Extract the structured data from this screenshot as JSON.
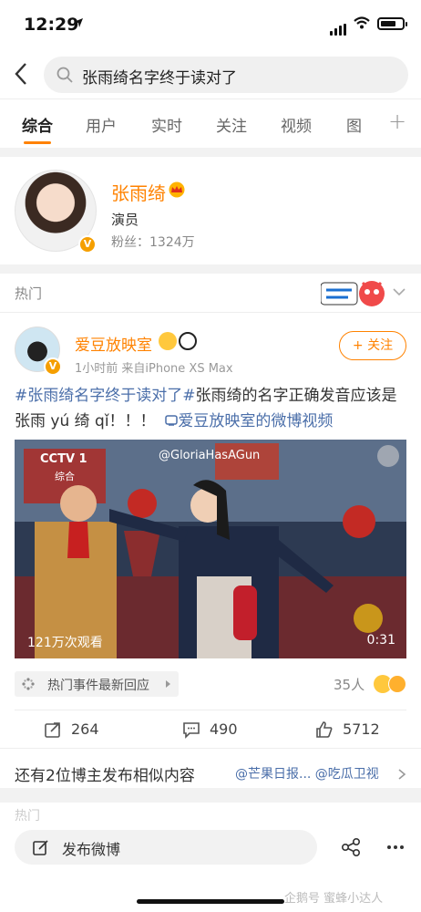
{
  "status": {
    "time": "12:29"
  },
  "search": {
    "query": "张雨绮名字终于读对了"
  },
  "tabs": [
    {
      "label": "综合"
    },
    {
      "label": "用户"
    },
    {
      "label": "实时"
    },
    {
      "label": "关注"
    },
    {
      "label": "视频"
    },
    {
      "label": "图"
    }
  ],
  "user_card": {
    "name": "张雨绮",
    "title": "演员",
    "fans": "粉丝：1324万"
  },
  "post": {
    "section_label": "热门",
    "author": "爱豆放映室",
    "meta": "1小时前  来自iPhone XS Max",
    "follow_label": "+ 关注",
    "hashtag": "#张雨绮名字终于读对了#",
    "body": "张雨绮的名字正确发音应该是张雨 yú 绮 qǐ！！！",
    "video_link": "爱豆放映室的微博视频",
    "video": {
      "watermark": "@GloriaHasAGun",
      "channel": "CCTV 1",
      "channel_sub": "综合",
      "views": "121万次观看",
      "duration": "0:31"
    },
    "event_tag": "热门事件最新回应",
    "reactors": "35人",
    "shares": "264",
    "comments": "490",
    "likes": "5712"
  },
  "similar": {
    "text": "还有2位博主发布相似内容",
    "links": "@芒果日报... @吃瓜卫视"
  },
  "peek_label": "热门",
  "bottom": {
    "post_label": "发布微博",
    "watermark": "企鹅号 蜜蜂小达人"
  }
}
